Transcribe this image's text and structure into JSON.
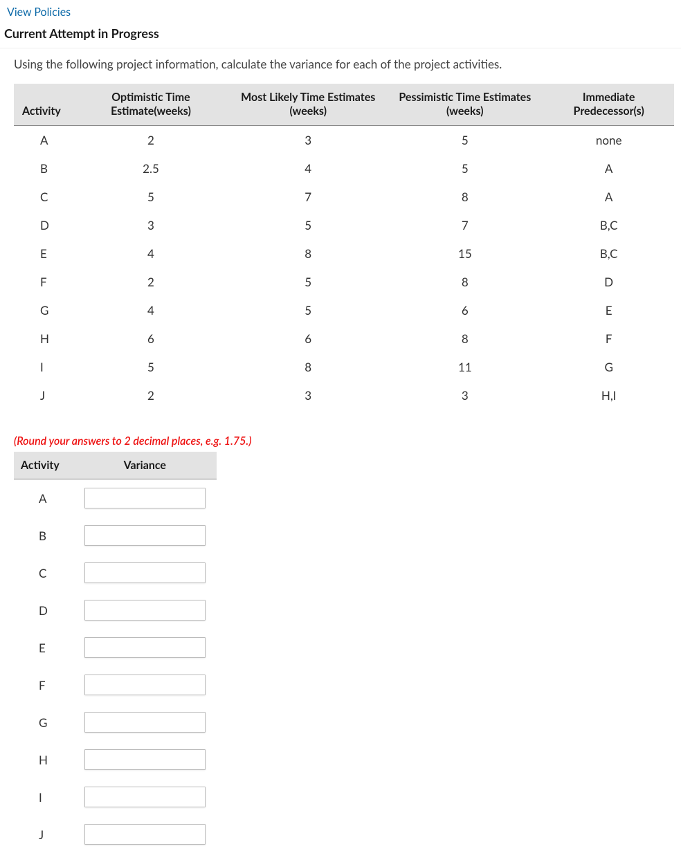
{
  "header": {
    "policies_link": "View Policies",
    "attempt_heading": "Current Attempt in Progress"
  },
  "question": {
    "prompt": "Using the following project information, calculate the variance for each of the project activities.",
    "data_table": {
      "headers": {
        "activity": "Activity",
        "optimistic": "Optimistic Time Estimate(weeks)",
        "most_likely": "Most Likely Time Estimates (weeks)",
        "pessimistic": "Pessimistic Time Estimates (weeks)",
        "predecessor": "Immediate Predecessor(s)"
      },
      "rows": [
        {
          "activity": "A",
          "optimistic": "2",
          "most_likely": "3",
          "pessimistic": "5",
          "predecessor": "none"
        },
        {
          "activity": "B",
          "optimistic": "2.5",
          "most_likely": "4",
          "pessimistic": "5",
          "predecessor": "A"
        },
        {
          "activity": "C",
          "optimistic": "5",
          "most_likely": "7",
          "pessimistic": "8",
          "predecessor": "A"
        },
        {
          "activity": "D",
          "optimistic": "3",
          "most_likely": "5",
          "pessimistic": "7",
          "predecessor": "B,C"
        },
        {
          "activity": "E",
          "optimistic": "4",
          "most_likely": "8",
          "pessimistic": "15",
          "predecessor": "B,C"
        },
        {
          "activity": "F",
          "optimistic": "2",
          "most_likely": "5",
          "pessimistic": "8",
          "predecessor": "D"
        },
        {
          "activity": "G",
          "optimistic": "4",
          "most_likely": "5",
          "pessimistic": "6",
          "predecessor": "E"
        },
        {
          "activity": "H",
          "optimistic": "6",
          "most_likely": "6",
          "pessimistic": "8",
          "predecessor": "F"
        },
        {
          "activity": "I",
          "optimistic": "5",
          "most_likely": "8",
          "pessimistic": "11",
          "predecessor": "G"
        },
        {
          "activity": "J",
          "optimistic": "2",
          "most_likely": "3",
          "pessimistic": "3",
          "predecessor": "H,I"
        }
      ]
    },
    "round_note": "(Round your answers to 2 decimal places, e.g. 1.75.)",
    "answer_table": {
      "headers": {
        "activity": "Activity",
        "variance": "Variance"
      },
      "rows": [
        {
          "activity": "A",
          "value": ""
        },
        {
          "activity": "B",
          "value": ""
        },
        {
          "activity": "C",
          "value": ""
        },
        {
          "activity": "D",
          "value": ""
        },
        {
          "activity": "E",
          "value": ""
        },
        {
          "activity": "F",
          "value": ""
        },
        {
          "activity": "G",
          "value": ""
        },
        {
          "activity": "H",
          "value": ""
        },
        {
          "activity": "I",
          "value": ""
        },
        {
          "activity": "J",
          "value": ""
        }
      ]
    }
  }
}
